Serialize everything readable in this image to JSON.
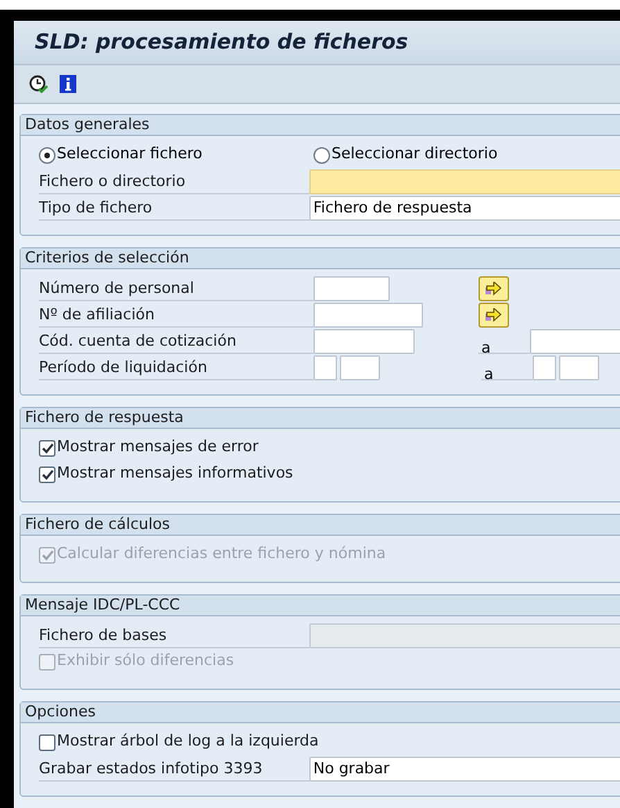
{
  "title": "SLD: procesamiento de ficheros",
  "sections": [
    {
      "title": "Datos generales",
      "rows": [
        {
          "kind": "radios",
          "options": [
            {
              "label": "Seleccionar fichero",
              "selected": true
            },
            {
              "label": "Seleccionar directorio",
              "selected": false
            }
          ]
        },
        {
          "kind": "field",
          "label": "Fichero o directorio",
          "required": true,
          "disabled": false
        },
        {
          "kind": "field",
          "label": "Tipo de fichero",
          "value": "Fichero de respuesta",
          "required": false,
          "disabled": false
        }
      ]
    },
    {
      "title": "Criterios de selección",
      "rows": [
        {
          "kind": "select",
          "label": "Número de personal"
        },
        {
          "kind": "select",
          "label": "Nº de afiliación"
        },
        {
          "kind": "interval",
          "label": "Cód. cuenta de cotización",
          "to_label": "a"
        },
        {
          "kind": "period",
          "label": "Período de liquidación",
          "to_label": "a"
        }
      ]
    },
    {
      "title": "Fichero de respuesta",
      "rows": [
        {
          "kind": "checkbox",
          "label": "Mostrar mensajes de error",
          "checked": true,
          "disabled": false
        },
        {
          "kind": "checkbox",
          "label": "Mostrar mensajes informativos",
          "checked": true,
          "disabled": false
        }
      ]
    },
    {
      "title": "Fichero de cálculos",
      "rows": [
        {
          "kind": "checkbox",
          "label": "Calcular diferencias entre fichero y nómina",
          "checked": true,
          "disabled": true
        }
      ]
    },
    {
      "title": "Mensaje IDC/PL-CCC",
      "rows": [
        {
          "kind": "field",
          "label": "Fichero de bases",
          "required": false,
          "disabled": true
        },
        {
          "kind": "checkbox",
          "label": "Exhibir sólo diferencias",
          "checked": false,
          "disabled": true
        }
      ]
    },
    {
      "title": "Opciones",
      "rows": [
        {
          "kind": "checkbox",
          "label": "Mostrar árbol de log a la izquierda",
          "checked": false,
          "disabled": false
        },
        {
          "kind": "field",
          "label": "Grabar estados infotipo 3393",
          "value": "No grabar",
          "required": false,
          "disabled": false
        }
      ]
    }
  ]
}
